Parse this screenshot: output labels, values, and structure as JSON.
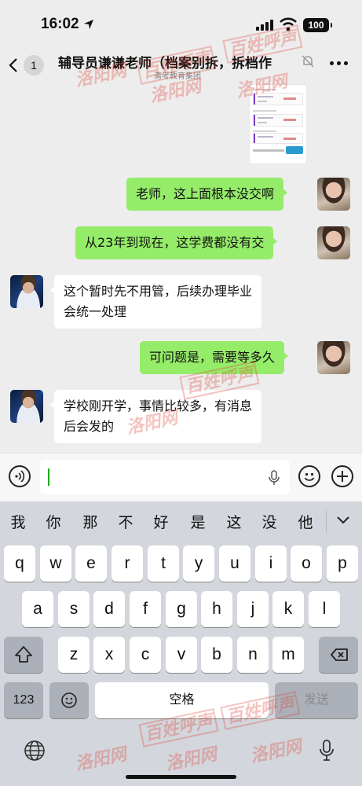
{
  "status_bar": {
    "time": "16:02",
    "battery": "100"
  },
  "nav": {
    "back_badge": "1",
    "title": "辅导员谦谦老师（档案别拆，拆档作",
    "subtitle": "清考教育集团"
  },
  "messages": [
    {
      "side": "sent",
      "text": "老师，这上面根本没交啊"
    },
    {
      "side": "sent",
      "text": "从23年到现在，这学费都没有交"
    },
    {
      "side": "received",
      "text": "这个暂时先不用管，后续办理毕业会统一处理",
      "line1": "这个暂时先不用管，后续办理毕业",
      "line2": "会统一处理"
    },
    {
      "side": "sent",
      "text": "可问题是，需要等多久"
    },
    {
      "side": "received",
      "text": "学校刚开学，事情比较多，有消息后会发的",
      "line1": "学校刚开学，事情比较多，有消息",
      "line2": "后会发的"
    }
  ],
  "keyboard": {
    "suggestions": [
      "我",
      "你",
      "那",
      "不",
      "好",
      "是",
      "这",
      "没",
      "他"
    ],
    "row1": [
      "q",
      "w",
      "e",
      "r",
      "t",
      "y",
      "u",
      "i",
      "o",
      "p"
    ],
    "row2": [
      "a",
      "s",
      "d",
      "f",
      "g",
      "h",
      "j",
      "k",
      "l"
    ],
    "row3": [
      "z",
      "x",
      "c",
      "v",
      "b",
      "n",
      "m"
    ],
    "numbers_label": "123",
    "space_label": "空格",
    "send_label": "发送"
  },
  "watermarks": {
    "source": "洛阳网",
    "column": "百姓呼声"
  },
  "colors": {
    "sent_bubble": "#95ec69",
    "received_bubble": "#ffffff",
    "background": "#ededed",
    "cursor": "#1aad19",
    "keyboard_bg": "#d3d6dc"
  }
}
